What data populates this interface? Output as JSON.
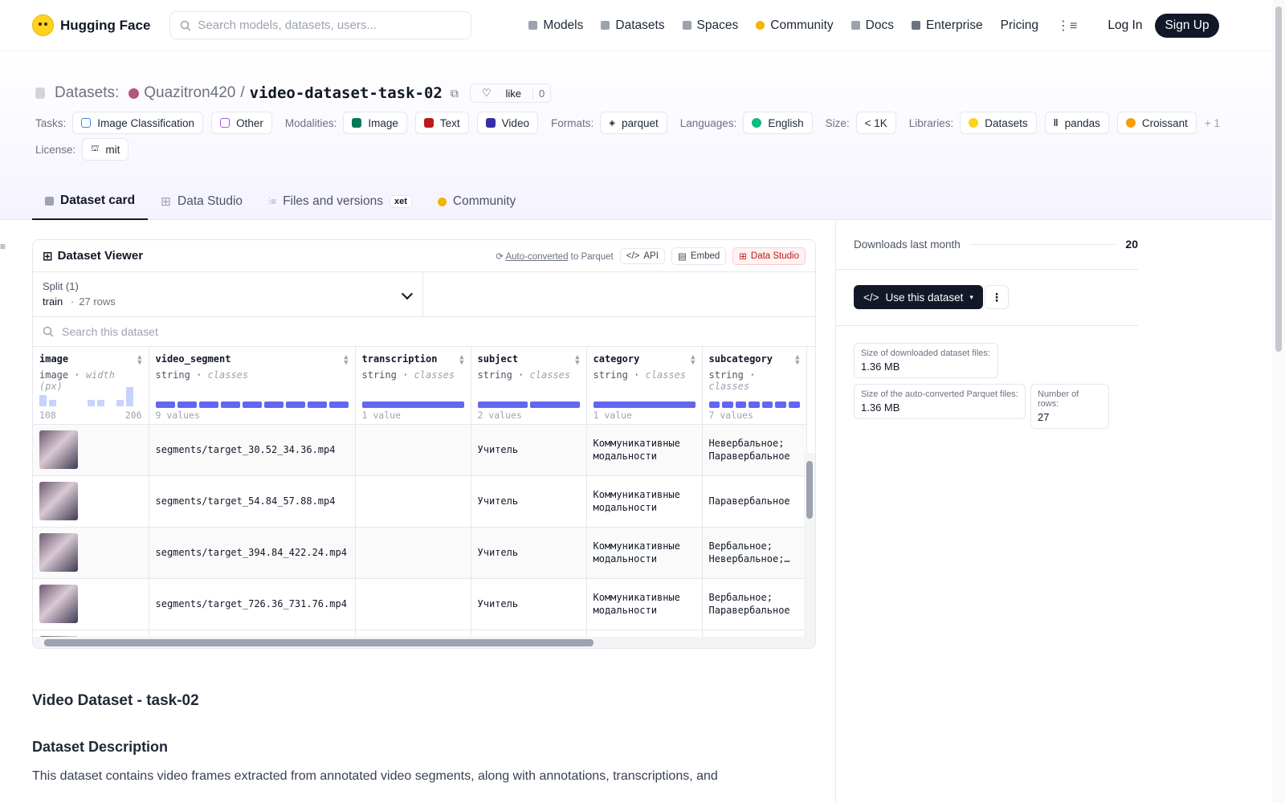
{
  "header": {
    "brand": "Hugging Face",
    "search_placeholder": "Search models, datasets, users...",
    "nav": [
      {
        "label": "Models",
        "icon": "cube-icon",
        "color": "#9ca3af"
      },
      {
        "label": "Datasets",
        "icon": "database-icon",
        "color": "#9ca3af"
      },
      {
        "label": "Spaces",
        "icon": "grid-icon",
        "color": "#9ca3af"
      },
      {
        "label": "Community",
        "icon": "hug-icon",
        "color": "#f5b400"
      },
      {
        "label": "Docs",
        "icon": "book-icon",
        "color": "#9ca3af"
      },
      {
        "label": "Enterprise",
        "icon": "enterprise-icon",
        "color": "#6b7280"
      },
      {
        "label": "Pricing",
        "icon": "",
        "color": ""
      }
    ],
    "login": "Log In",
    "signup": "Sign Up"
  },
  "repo": {
    "type_label": "Datasets:",
    "owner": "Quazitron420",
    "slash": "/",
    "name": "video-dataset-task-02",
    "like_label": "like",
    "like_count": "0"
  },
  "tags": {
    "tasks_label": "Tasks:",
    "tasks": [
      "Image Classification",
      "Other"
    ],
    "modalities_label": "Modalities:",
    "modalities": [
      "Image",
      "Text",
      "Video"
    ],
    "formats_label": "Formats:",
    "formats": [
      "parquet"
    ],
    "languages_label": "Languages:",
    "languages": [
      "English"
    ],
    "size_label": "Size:",
    "size": [
      "< 1K"
    ],
    "libraries_label": "Libraries:",
    "libraries": [
      "Datasets",
      "pandas",
      "Croissant"
    ],
    "libraries_more": "+ 1",
    "license_label": "License:",
    "license": [
      "mit"
    ]
  },
  "tabs": [
    {
      "label": "Dataset card",
      "active": true
    },
    {
      "label": "Data Studio"
    },
    {
      "label": "Files and versions",
      "badge": "xet"
    },
    {
      "label": "Community"
    }
  ],
  "viewer": {
    "title": "Dataset Viewer",
    "autoconverted": "Auto-converted",
    "to_parquet": "to Parquet",
    "api": "API",
    "embed": "Embed",
    "data_studio": "Data Studio",
    "split_label": "Split (1)",
    "split_name": "train",
    "split_dot": "·",
    "split_rows": "27 rows",
    "search_placeholder": "Search this dataset",
    "columns": [
      {
        "name": "image",
        "type": "image",
        "stat": "width (px)",
        "min": "108",
        "max": "206",
        "hist": [
          0.55,
          0.3,
          0,
          0,
          0,
          0.3,
          0.3,
          0,
          0.3,
          1
        ]
      },
      {
        "name": "video_segment",
        "type": "string",
        "stat": "classes",
        "count": "9 values",
        "segments": 9
      },
      {
        "name": "transcription",
        "type": "string",
        "stat": "classes",
        "count": "1 value",
        "segments": 1
      },
      {
        "name": "subject",
        "type": "string",
        "stat": "classes",
        "count": "2 values",
        "segments": 2
      },
      {
        "name": "category",
        "type": "string",
        "stat": "classes",
        "count": "1 value",
        "segments": 1
      },
      {
        "name": "subcategory",
        "type": "string",
        "stat": "classes",
        "count": "7 values",
        "segments": 7
      }
    ],
    "rows": [
      {
        "video_segment": "segments/target_30.52_34.36.mp4",
        "transcription": "",
        "subject": "Учитель",
        "category": "Коммуникативные модальности",
        "subcategory": "Невербальное; Паравербальное"
      },
      {
        "video_segment": "segments/target_54.84_57.88.mp4",
        "transcription": "",
        "subject": "Учитель",
        "category": "Коммуникативные модальности",
        "subcategory": "Паравербальное"
      },
      {
        "video_segment": "segments/target_394.84_422.24.mp4",
        "transcription": "",
        "subject": "Учитель",
        "category": "Коммуникативные модальности",
        "subcategory": "Вербальное; Невербальное;…"
      },
      {
        "video_segment": "segments/target_726.36_731.76.mp4",
        "transcription": "",
        "subject": "Учитель",
        "category": "Коммуникативные модальности",
        "subcategory": "Вербальное; Паравербальное"
      }
    ]
  },
  "sidebar": {
    "downloads_label": "Downloads last month",
    "downloads": "20",
    "use_button": "Use this dataset",
    "downloaded_size_label": "Size of downloaded dataset files:",
    "downloaded_size": "1.36 MB",
    "parquet_size_label": "Size of the auto-converted Parquet files:",
    "parquet_size": "1.36 MB",
    "rows_label": "Number of rows:",
    "rows": "27"
  },
  "card": {
    "title": "Video Dataset - task-02",
    "section": "Dataset Description",
    "text": "This dataset contains video frames extracted from annotated video segments, along with annotations, transcriptions, and"
  }
}
